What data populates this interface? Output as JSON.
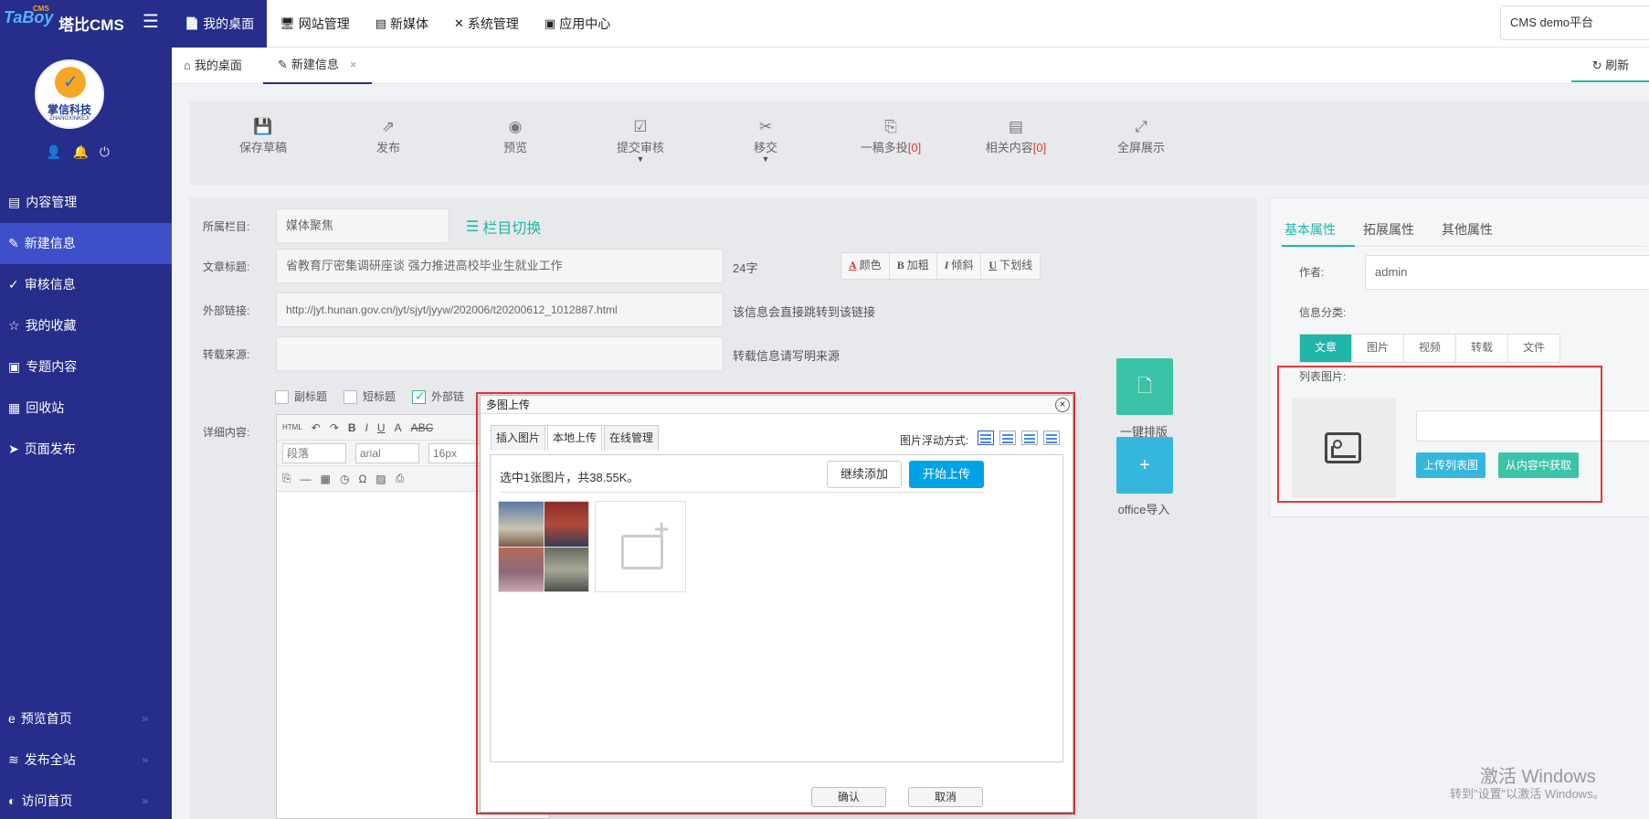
{
  "brand": {
    "logo_text": "TaBoy",
    "logo_sup": "CMS",
    "name": "塔比CMS"
  },
  "topnav": [
    {
      "label": "我的桌面",
      "icon": "📄"
    },
    {
      "label": "网站管理",
      "icon": "🖥"
    },
    {
      "label": "新媒体",
      "icon": "▤"
    },
    {
      "label": "系统管理",
      "icon": "✕"
    },
    {
      "label": "应用中心",
      "icon": "▣"
    }
  ],
  "site_selector": "CMS demo平台",
  "avatar": {
    "title": "掌信科技",
    "subtitle": "ZHANGXINKEJI"
  },
  "sidebar": {
    "items": [
      {
        "label": "内容管理",
        "icon": "▤"
      },
      {
        "label": "新建信息",
        "icon": "✎"
      },
      {
        "label": "审核信息",
        "icon": "✓"
      },
      {
        "label": "我的收藏",
        "icon": "☆"
      },
      {
        "label": "专题内容",
        "icon": "▣"
      },
      {
        "label": "回收站",
        "icon": "▦"
      },
      {
        "label": "页面发布",
        "icon": "➤"
      }
    ],
    "bottom": [
      {
        "label": "预览首页",
        "icon": "e"
      },
      {
        "label": "发布全站",
        "icon": "≋"
      },
      {
        "label": "访问首页",
        "icon": "◐"
      }
    ]
  },
  "tabs": {
    "items": [
      {
        "label": "我的桌面",
        "icon": "⌂"
      },
      {
        "label": "新建信息",
        "icon": "✎"
      }
    ],
    "refresh": "刷新"
  },
  "toolbar": [
    {
      "label": "保存草稿",
      "icon": "💾"
    },
    {
      "label": "发布",
      "icon": "⇗"
    },
    {
      "label": "预览",
      "icon": "◉"
    },
    {
      "label": "提交审核",
      "icon": "☑"
    },
    {
      "label": "移交",
      "icon": "✂"
    },
    {
      "label": "一稿多投",
      "count": "[0]",
      "icon": "⎘"
    },
    {
      "label": "相关内容",
      "count": "[0]",
      "icon": "▤"
    },
    {
      "label": "全屏展示",
      "icon": "⤢"
    }
  ],
  "form": {
    "column_label": "所属栏目:",
    "column_value": "媒体聚焦",
    "column_switch": "栏目切换",
    "title_label": "文章标题:",
    "title_value": "省教育厅密集调研座谈 强力推进高校毕业生就业工作",
    "title_count": "24字",
    "format_buttons": [
      {
        "glyph": "A",
        "label": "颜色"
      },
      {
        "glyph": "B",
        "label": "加粗"
      },
      {
        "glyph": "I",
        "label": "倾斜"
      },
      {
        "glyph": "U",
        "label": "下划线"
      }
    ],
    "link_label": "外部链接:",
    "link_value": "http://jyt.hunan.gov.cn/jyt/sjyt/jyyw/202006/t20200612_1012887.html",
    "link_hint": "该信息会直接跳转到该链接",
    "source_label": "转载来源:",
    "source_hint": "转载信息请写明来源",
    "checkboxes": [
      {
        "label": "副标题",
        "checked": false
      },
      {
        "label": "短标题",
        "checked": false
      },
      {
        "label": "外部链",
        "checked": true
      }
    ],
    "content_label": "详细内容:",
    "editor": {
      "paragraph": "段落",
      "font": "arial",
      "size": "16px"
    },
    "one_click_layout": "一键排版",
    "office_import": "office导入"
  },
  "right_panel": {
    "tabs": [
      "基本属性",
      "拓展属性",
      "其他属性"
    ],
    "author_label": "作者:",
    "author_value": "admin",
    "category_label": "信息分类:",
    "categories": [
      "文章",
      "图片",
      "视频",
      "转载",
      "文件"
    ],
    "list_image_label": "列表图片:",
    "upload_list_btn": "上传列表图",
    "from_content_btn": "从内容中获取"
  },
  "dialog": {
    "title": "多图上传",
    "tabs": [
      "插入图片",
      "本地上传",
      "在线管理"
    ],
    "float_label": "图片浮动方式:",
    "status": "选中1张图片，共38.55K。",
    "continue_btn": "继续添加",
    "start_btn": "开始上传",
    "confirm_btn": "确认",
    "cancel_btn": "取消"
  },
  "watermark": {
    "line1": "激活 Windows",
    "line2": "转到\"设置\"以激活 Windows。"
  },
  "colors": {
    "sidebar": "#262d8a",
    "active_item": "#3f4fc9",
    "teal": "#1fb5a8",
    "blue": "#00a2e6",
    "highlight_red": "#e53935"
  }
}
